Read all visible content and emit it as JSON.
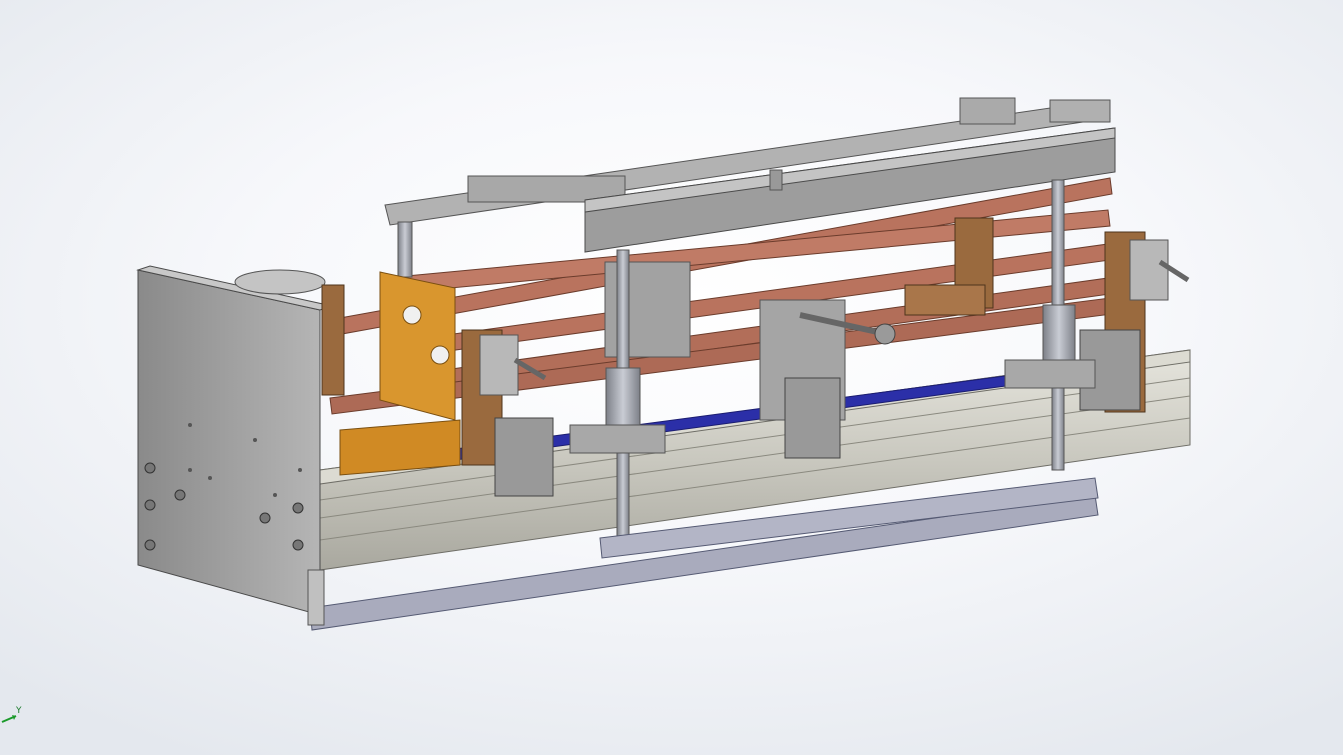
{
  "viewport": {
    "background": "#eef1f5"
  },
  "model": {
    "parts": [
      "base-plate",
      "aluminum-extrusion-rail",
      "copper-bus-bar",
      "wooden-fixture",
      "toggle-clamp",
      "linear-guide-rod",
      "top-support-frame",
      "bottom-foot-bar"
    ],
    "colors": {
      "steel": "#9a9a9a",
      "extrusion": "#c9c8bf",
      "copper": "#b9735e",
      "wood_orange": "#d9962e",
      "wood_brown": "#9a6a3e",
      "blue_strip": "#2b2fa8",
      "foot_bar": "#a9abbd"
    }
  },
  "triad": {
    "y_label": "Y",
    "icon": "coordinate-triad-icon"
  }
}
